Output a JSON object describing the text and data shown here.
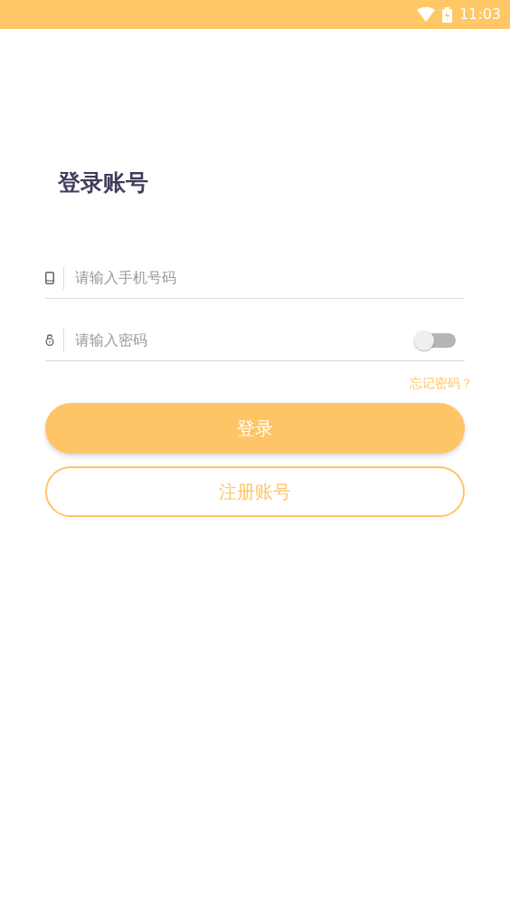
{
  "status_bar": {
    "time": "11:03"
  },
  "title": "登录账号",
  "phone_field": {
    "placeholder": "请输入手机号码"
  },
  "password_field": {
    "placeholder": "请输入密码",
    "show_password": {
      "on": false
    }
  },
  "forgot_link": "忘记密码？",
  "login_button": "登录",
  "register_button": "注册账号"
}
